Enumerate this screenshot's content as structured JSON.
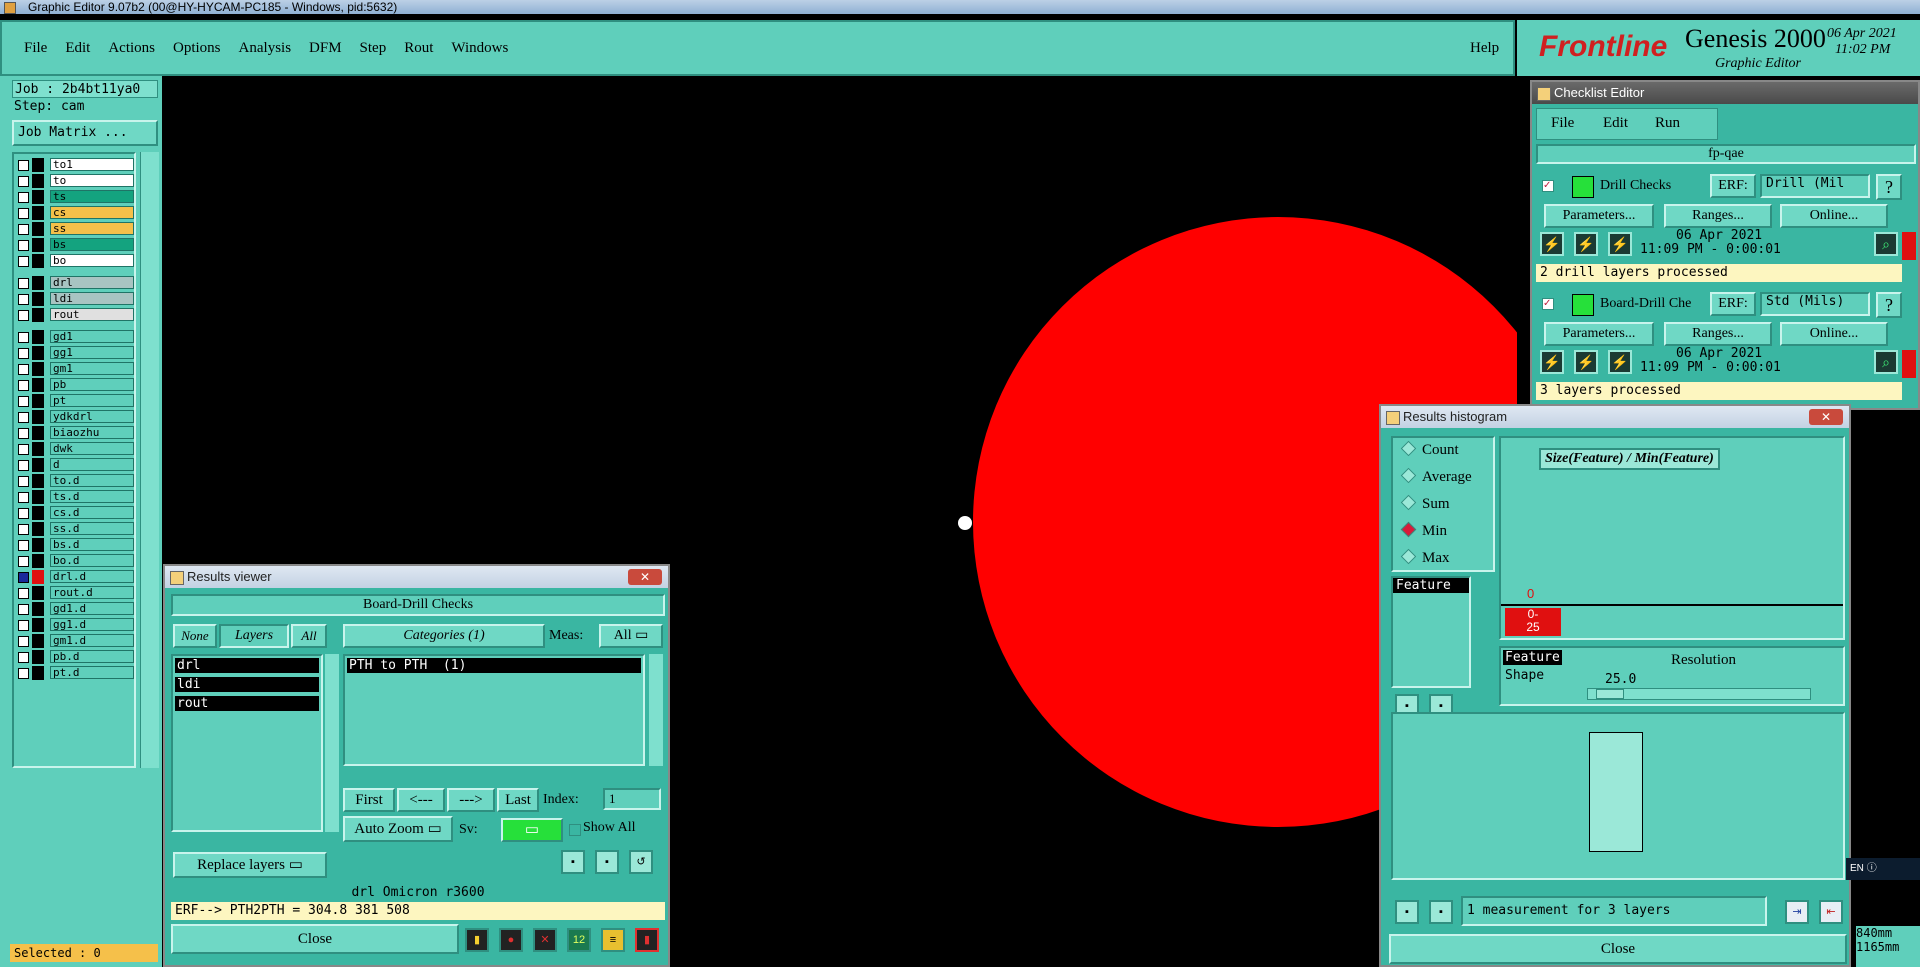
{
  "titlebar": {
    "text": "Graphic Editor 9.07b2 (00@HY-HYCAM-PC185 - Windows, pid:5632)"
  },
  "menubar": {
    "items": [
      "File",
      "Edit",
      "Actions",
      "Options",
      "Analysis",
      "DFM",
      "Step",
      "Rout",
      "Windows"
    ],
    "help": "Help"
  },
  "brand": {
    "logo": "Frontline",
    "product": "Genesis 2000",
    "sub": "Graphic Editor",
    "date": "06 Apr 2021",
    "time": "11:02 PM"
  },
  "left_panel": {
    "job": "Job : 2b4bt11ya0",
    "step": "Step: cam",
    "job_matrix": "Job Matrix ...",
    "selected": "Selected : 0",
    "layers": [
      {
        "name": "to1",
        "bg": "#ffffff"
      },
      {
        "name": "to",
        "bg": "#ffffff"
      },
      {
        "name": "ts",
        "bg": "#14a37f"
      },
      {
        "name": "cs",
        "bg": "#f5c04a"
      },
      {
        "name": "ss",
        "bg": "#f5c04a"
      },
      {
        "name": "bs",
        "bg": "#14a37f"
      },
      {
        "name": "bo",
        "bg": "#ffffff"
      },
      {
        "name": "drl",
        "bg": "#a8c4c2"
      },
      {
        "name": "ldi",
        "bg": "#a8c4c2"
      },
      {
        "name": "rout",
        "bg": "#e0e0e0"
      },
      {
        "name": "gd1",
        "bg": "#5fcfbb"
      },
      {
        "name": "gg1",
        "bg": "#5fcfbb"
      },
      {
        "name": "gm1",
        "bg": "#5fcfbb"
      },
      {
        "name": "pb",
        "bg": "#5fcfbb"
      },
      {
        "name": "pt",
        "bg": "#5fcfbb"
      },
      {
        "name": "ydkdrl",
        "bg": "#5fcfbb"
      },
      {
        "name": "biaozhu",
        "bg": "#5fcfbb"
      },
      {
        "name": "dwk",
        "bg": "#5fcfbb"
      },
      {
        "name": "d",
        "bg": "#5fcfbb"
      },
      {
        "name": "to.d",
        "bg": "#5fcfbb"
      },
      {
        "name": "ts.d",
        "bg": "#5fcfbb"
      },
      {
        "name": "cs.d",
        "bg": "#5fcfbb"
      },
      {
        "name": "ss.d",
        "bg": "#5fcfbb"
      },
      {
        "name": "bs.d",
        "bg": "#5fcfbb"
      },
      {
        "name": "bo.d",
        "bg": "#5fcfbb"
      },
      {
        "name": "drl.d",
        "bg": "#5fcfbb"
      },
      {
        "name": "rout.d",
        "bg": "#5fcfbb"
      },
      {
        "name": "gd1.d",
        "bg": "#5fcfbb"
      },
      {
        "name": "gg1.d",
        "bg": "#5fcfbb"
      },
      {
        "name": "gm1.d",
        "bg": "#5fcfbb"
      },
      {
        "name": "pb.d",
        "bg": "#5fcfbb"
      },
      {
        "name": "pt.d",
        "bg": "#5fcfbb"
      }
    ]
  },
  "results_viewer": {
    "title": "Results viewer",
    "header": "Board-Drill Checks",
    "none": "None",
    "layers": "Layers",
    "all": "All",
    "categories": "Categories (1)",
    "meas_label": "Meas:",
    "meas_value": "All",
    "layer_list": [
      "drl",
      "ldi",
      "rout"
    ],
    "category_list": [
      "PTH to PTH  (1)"
    ],
    "first": "First",
    "prev": "<---",
    "next": "--->",
    "last": "Last",
    "index_label": "Index:",
    "index_value": "1",
    "auto_zoom": "Auto Zoom",
    "sv_label": "Sv:",
    "show_all": "Show All",
    "replace_layers": "Replace layers",
    "info": "drl Omicron  r3600",
    "erf": "ERF--> PTH2PTH = 304.8 381 508",
    "close": "Close"
  },
  "checklist": {
    "title": "Checklist Editor",
    "menu": [
      "File",
      "Edit",
      "Run"
    ],
    "name": "fp-qae",
    "checks": [
      {
        "name": "Drill Checks",
        "erf_label": "ERF:",
        "erf": "Drill (Mil",
        "params": "Parameters...",
        "ranges": "Ranges...",
        "online": "Online...",
        "date": "06 Apr 2021",
        "time": "11:09 PM - 0:00:01",
        "status": "2 drill layers processed"
      },
      {
        "name": "Board-Drill Che",
        "erf_label": "ERF:",
        "erf": "Std (Mils)",
        "params": "Parameters...",
        "ranges": "Ranges...",
        "online": "Online...",
        "date": "06 Apr 2021",
        "time": "11:09 PM - 0:00:01",
        "status": "3 layers processed"
      }
    ]
  },
  "histogram": {
    "title": "Results histogram",
    "options": [
      "Count",
      "Average",
      "Sum",
      "Min",
      "Max"
    ],
    "selected": "Min",
    "formula": "Size(Feature) / Min(Feature)",
    "axis_zero": "0",
    "bin_label": "0-\n25",
    "list_item": "Feature",
    "res_items": [
      "Feature",
      "Shape"
    ],
    "resolution_label": "Resolution",
    "resolution": "25.0",
    "status": "1 measurement for 3 layers",
    "close": "Close"
  },
  "tray": {
    "lang": "EN",
    "dim1": "840mm",
    "dim2": "1165mm"
  }
}
